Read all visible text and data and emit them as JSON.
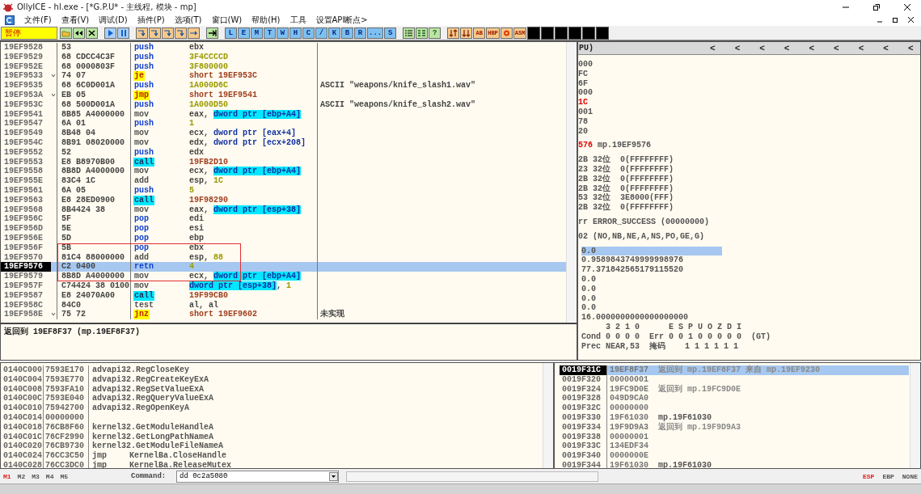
{
  "window": {
    "title": "OllyICE - hl.exe - [*G.P.U* - 主线程, 模块 - mp]"
  },
  "menu": [
    "文件(F)",
    "查看(V)",
    "调试(D)",
    "插件(P)",
    "选项(T)",
    "窗口(W)",
    "帮助(H)",
    "工具",
    "设置API断点>"
  ],
  "toolbar": {
    "status": "暂停",
    "view_buttons": [
      "L",
      "E",
      "M",
      "T",
      "W",
      "H",
      "C",
      "/",
      "K",
      "B",
      "R",
      "...",
      "S"
    ],
    "help_button": "?",
    "tool_labels": [
      "AB",
      "HBP",
      "ASM"
    ]
  },
  "disasm": {
    "rows": [
      {
        "address": "19EF9528",
        "jump_mark": false,
        "bytes": "53",
        "mnemonic": "push",
        "kind": "push",
        "operand": [
          {
            "text": "ebx",
            "kind": "reg"
          }
        ],
        "selected": false
      },
      {
        "address": "19EF9529",
        "jump_mark": false,
        "bytes": "68 CDCC4C3F",
        "mnemonic": "push",
        "kind": "push",
        "operand": [
          {
            "text": "3F4CCCCD",
            "kind": "imm"
          }
        ],
        "selected": false
      },
      {
        "address": "19EF952E",
        "jump_mark": false,
        "bytes": "68 0000803F",
        "mnemonic": "push",
        "kind": "push",
        "operand": [
          {
            "text": "3F800000",
            "kind": "imm"
          }
        ],
        "selected": false
      },
      {
        "address": "19EF9533",
        "jump_mark": true,
        "bytes": "74 07",
        "mnemonic": "je",
        "kind": "jump",
        "operand": [
          {
            "text": "short 19EF953C",
            "kind": "target"
          }
        ],
        "selected": false
      },
      {
        "address": "19EF9535",
        "jump_mark": false,
        "bytes": "68 6C0D001A",
        "mnemonic": "push",
        "kind": "push",
        "operand": [
          {
            "text": "1A000D6C",
            "kind": "imm"
          }
        ],
        "comment": "ASCII \"weapons/knife_slash1.wav\"",
        "selected": false
      },
      {
        "address": "19EF953A",
        "jump_mark": true,
        "bytes": "EB 05",
        "mnemonic": "jmp",
        "kind": "jump",
        "operand": [
          {
            "text": "short 19EF9541",
            "kind": "target"
          }
        ],
        "selected": false
      },
      {
        "address": "19EF953C",
        "jump_mark": false,
        "bytes": "68 500D001A",
        "mnemonic": "push",
        "kind": "push",
        "operand": [
          {
            "text": "1A000D50",
            "kind": "imm"
          }
        ],
        "comment": "ASCII \"weapons/knife_slash2.wav\"",
        "selected": false
      },
      {
        "address": "19EF9541",
        "jump_mark": false,
        "bytes": "8B85 A4000000",
        "mnemonic": "mov",
        "kind": "plain",
        "operand": [
          {
            "text": "eax, ",
            "kind": "reg"
          },
          {
            "text": "dword ptr [ebp+A4]",
            "kind": "mem"
          }
        ],
        "selected": false
      },
      {
        "address": "19EF9547",
        "jump_mark": false,
        "bytes": "6A 01",
        "mnemonic": "push",
        "kind": "push",
        "operand": [
          {
            "text": "1",
            "kind": "imm"
          }
        ],
        "selected": false
      },
      {
        "address": "19EF9549",
        "jump_mark": false,
        "bytes": "8B48 04",
        "mnemonic": "mov",
        "kind": "plain",
        "operand": [
          {
            "text": "ecx, ",
            "kind": "reg"
          },
          {
            "text": "dword ptr [eax+4]",
            "kind": "memref"
          }
        ],
        "selected": false
      },
      {
        "address": "19EF954C",
        "jump_mark": false,
        "bytes": "8B91 08020000",
        "mnemonic": "mov",
        "kind": "plain",
        "operand": [
          {
            "text": "edx, ",
            "kind": "reg"
          },
          {
            "text": "dword ptr [ecx+208]",
            "kind": "memref"
          }
        ],
        "selected": false
      },
      {
        "address": "19EF9552",
        "jump_mark": false,
        "bytes": "52",
        "mnemonic": "push",
        "kind": "push",
        "operand": [
          {
            "text": "edx",
            "kind": "reg"
          }
        ],
        "selected": false
      },
      {
        "address": "19EF9553",
        "jump_mark": false,
        "bytes": "E8 B8970B00",
        "mnemonic": "call",
        "kind": "call",
        "operand": [
          {
            "text": "19FB2D10",
            "kind": "target"
          }
        ],
        "selected": false
      },
      {
        "address": "19EF9558",
        "jump_mark": false,
        "bytes": "8B8D A4000000",
        "mnemonic": "mov",
        "kind": "plain",
        "operand": [
          {
            "text": "ecx, ",
            "kind": "reg"
          },
          {
            "text": "dword ptr [ebp+A4]",
            "kind": "mem"
          }
        ],
        "selected": false
      },
      {
        "address": "19EF955E",
        "jump_mark": false,
        "bytes": "83C4 1C",
        "mnemonic": "add",
        "kind": "plain",
        "operand": [
          {
            "text": "esp, ",
            "kind": "reg"
          },
          {
            "text": "1C",
            "kind": "imm"
          }
        ],
        "selected": false
      },
      {
        "address": "19EF9561",
        "jump_mark": false,
        "bytes": "6A 05",
        "mnemonic": "push",
        "kind": "push",
        "operand": [
          {
            "text": "5",
            "kind": "imm"
          }
        ],
        "selected": false
      },
      {
        "address": "19EF9563",
        "jump_mark": false,
        "bytes": "E8 28ED0900",
        "mnemonic": "call",
        "kind": "call",
        "operand": [
          {
            "text": "19F98290",
            "kind": "target"
          }
        ],
        "selected": false
      },
      {
        "address": "19EF9568",
        "jump_mark": false,
        "bytes": "8B4424 38",
        "mnemonic": "mov",
        "kind": "plain",
        "operand": [
          {
            "text": "eax, ",
            "kind": "reg"
          },
          {
            "text": "dword ptr [esp+38]",
            "kind": "mem"
          }
        ],
        "selected": false
      },
      {
        "address": "19EF956C",
        "jump_mark": false,
        "bytes": "5F",
        "mnemonic": "pop",
        "kind": "pop",
        "operand": [
          {
            "text": "edi",
            "kind": "reg"
          }
        ],
        "selected": false
      },
      {
        "address": "19EF956D",
        "jump_mark": false,
        "bytes": "5E",
        "mnemonic": "pop",
        "kind": "pop",
        "operand": [
          {
            "text": "esi",
            "kind": "reg"
          }
        ],
        "selected": false
      },
      {
        "address": "19EF956E",
        "jump_mark": false,
        "bytes": "5D",
        "mnemonic": "pop",
        "kind": "pop",
        "operand": [
          {
            "text": "ebp",
            "kind": "reg"
          }
        ],
        "selected": false
      },
      {
        "address": "19EF956F",
        "jump_mark": false,
        "bytes": "5B",
        "mnemonic": "pop",
        "kind": "pop",
        "operand": [
          {
            "text": "ebx",
            "kind": "reg"
          }
        ],
        "selected": false
      },
      {
        "address": "19EF9570",
        "jump_mark": false,
        "bytes": "81C4 88000000",
        "mnemonic": "add",
        "kind": "plain",
        "operand": [
          {
            "text": "esp, ",
            "kind": "reg"
          },
          {
            "text": "88",
            "kind": "imm"
          }
        ],
        "selected": false
      },
      {
        "address": "19EF9576",
        "jump_mark": false,
        "bytes": "C2 0400",
        "mnemonic": "retn",
        "kind": "pop",
        "operand": [
          {
            "text": "4",
            "kind": "imm"
          }
        ],
        "selected": true
      },
      {
        "address": "19EF9579",
        "jump_mark": false,
        "bytes": "8B8D A4000000",
        "mnemonic": "mov",
        "kind": "plain",
        "operand": [
          {
            "text": "ecx, ",
            "kind": "reg"
          },
          {
            "text": "dword ptr [ebp+A4]",
            "kind": "mem"
          }
        ],
        "selected": false
      },
      {
        "address": "19EF957F",
        "jump_mark": false,
        "bytes": "C74424 38 0100",
        "mnemonic": "mov",
        "kind": "plain",
        "operand": [
          {
            "text": "dword ptr [esp+38]",
            "kind": "mem"
          },
          {
            "text": ", ",
            "kind": "reg"
          },
          {
            "text": "1",
            "kind": "imm"
          }
        ],
        "selected": false
      },
      {
        "address": "19EF9587",
        "jump_mark": false,
        "bytes": "E8 24070A00",
        "mnemonic": "call",
        "kind": "call",
        "operand": [
          {
            "text": "19F99CB0",
            "kind": "target"
          }
        ],
        "selected": false
      },
      {
        "address": "19EF958C",
        "jump_mark": false,
        "bytes": "84C0",
        "mnemonic": "test",
        "kind": "plain",
        "operand": [
          {
            "text": "al, al",
            "kind": "reg"
          }
        ],
        "selected": false
      },
      {
        "address": "19EF958E",
        "jump_mark": true,
        "bytes": "75 72",
        "mnemonic": "jnz",
        "kind": "jump",
        "operand": [
          {
            "text": "short 19EF9602",
            "kind": "target"
          }
        ],
        "comment": "未实现",
        "selected": false
      }
    ]
  },
  "info": {
    "text": "返回到 19EF8F37 (mp.19EF8F37)"
  },
  "annotation": {
    "kind": "rectangle"
  },
  "registers": {
    "title": "PU)",
    "buttons": [
      "<",
      "<",
      "<",
      "<",
      "<",
      "<",
      "<",
      "<",
      "<"
    ],
    "groups": [
      {
        "kind": "registers",
        "lines": [
          {
            "text": "000",
            "changed": false,
            "selected": false
          },
          {
            "text": "FC",
            "changed": false,
            "selected": false
          },
          {
            "text": "6F",
            "changed": false,
            "selected": false
          },
          {
            "text": "000",
            "changed": false,
            "selected": false
          },
          {
            "text": "1C",
            "changed": true,
            "selected": false
          },
          {
            "text": "001",
            "changed": false,
            "selected": false
          },
          {
            "text": "78",
            "changed": false,
            "selected": false
          },
          {
            "text": "20",
            "changed": false,
            "selected": false
          }
        ]
      },
      {
        "kind": "registers",
        "lines": [
          {
            "text": "576",
            "changed": true,
            "comment": "mp.19EF9576",
            "selected": false
          }
        ]
      },
      {
        "kind": "registers",
        "lines": [
          {
            "text": "2B",
            "changed": false,
            "comment": "32位  0(FFFFFFFF)",
            "selected": false
          },
          {
            "text": "23",
            "changed": false,
            "comment": "32位  0(FFFFFFFF)",
            "selected": false
          },
          {
            "text": "2B",
            "changed": false,
            "comment": "32位  0(FFFFFFFF)",
            "selected": false
          },
          {
            "text": "2B",
            "changed": false,
            "comment": "32位  0(FFFFFFFF)",
            "selected": false
          },
          {
            "text": "53",
            "changed": false,
            "comment": "32位  3E8000(FFF)",
            "selected": false
          },
          {
            "text": "2B",
            "changed": false,
            "comment": "32位  0(FFFFFFFF)",
            "selected": false
          }
        ]
      },
      {
        "kind": "registers",
        "lines": [
          {
            "text": "rr",
            "changed": false,
            "comment": "ERROR_SUCCESS (00000000)",
            "selected": false
          }
        ]
      },
      {
        "kind": "registers",
        "lines": [
          {
            "text": "02",
            "changed": false,
            "comment": "(NO,NB,NE,A,NS,PO,GE,G)",
            "selected": false
          }
        ]
      },
      {
        "kind": "fpu",
        "lines": [
          {
            "text": "0.0",
            "changed": false,
            "selected": true
          },
          {
            "text": "0.9589843749999998976",
            "changed": false,
            "selected": false
          },
          {
            "text": "77.371842565179115520",
            "changed": false,
            "selected": false
          },
          {
            "text": "0.0",
            "changed": false,
            "selected": false
          },
          {
            "text": "0.0",
            "changed": false,
            "selected": false
          },
          {
            "text": "0.0",
            "changed": false,
            "selected": false
          },
          {
            "text": "0.0",
            "changed": false,
            "selected": false
          },
          {
            "text": "16.0000000000000000000",
            "changed": false,
            "selected": false
          },
          {
            "text": "     3 2 1 0      E S P U O Z D I",
            "changed": false,
            "selected": false
          },
          {
            "text": "Cond 0 0 0 0  Err 0 0 1 0 0 0 0 0  (GT)",
            "changed": false,
            "selected": false
          },
          {
            "text": "Prec NEAR,53  掩码    1 1 1 1 1 1",
            "changed": false,
            "selected": false
          }
        ]
      }
    ]
  },
  "dump": {
    "rows": [
      {
        "address": "0140C000",
        "value": "7593E170",
        "comment": "advapi32.RegCloseKey"
      },
      {
        "address": "0140C004",
        "value": "7593E770",
        "comment": "advapi32.RegCreateKeyExA"
      },
      {
        "address": "0140C008",
        "value": "7593FA10",
        "comment": "advapi32.RegSetValueExA"
      },
      {
        "address": "0140C00C",
        "value": "7593E040",
        "comment": "advapi32.RegQueryValueExA"
      },
      {
        "address": "0140C010",
        "value": "75942700",
        "comment": "advapi32.RegOpenKeyA"
      },
      {
        "address": "0140C014",
        "value": "00000000"
      },
      {
        "address": "0140C018",
        "value": "76CB8F60",
        "comment": "kernel32.GetModuleHandleA"
      },
      {
        "address": "0140C01C",
        "value": "76CF2990",
        "comment": "kernel32.GetLongPathNameA"
      },
      {
        "address": "0140C020",
        "value": "76CB9730",
        "comment": "kernel32.GetModuleFileNameA"
      },
      {
        "address": "0140C024",
        "value": "76CC3C50",
        "prefix": "jmp",
        "comment": "KernelBa.CloseHandle"
      },
      {
        "address": "0140C028",
        "value": "76CC3DC0",
        "prefix": "jmp",
        "comment": "KernelBa.ReleaseMutex"
      }
    ]
  },
  "stack": {
    "rows": [
      {
        "address": "0019F31C",
        "value": "19EF8F37",
        "comment": "返回到 mp.19EF8F37 来自 mp.19EF9230",
        "kind": "return",
        "selected": true
      },
      {
        "address": "0019F320",
        "value": "00000001",
        "selected": false
      },
      {
        "address": "0019F324",
        "value": "19FC9D0E",
        "comment": "返回到 mp.19FC9D0E",
        "kind": "return",
        "selected": false
      },
      {
        "address": "0019F328",
        "value": "049D9CA0",
        "selected": false
      },
      {
        "address": "0019F32C",
        "value": "00000000",
        "selected": false
      },
      {
        "address": "0019F330",
        "value": "19F61030",
        "comment": "mp.19F61030",
        "kind": "plain",
        "selected": false
      },
      {
        "address": "0019F334",
        "value": "19F9D9A3",
        "comment": "返回到 mp.19F9D9A3",
        "kind": "return",
        "selected": false
      },
      {
        "address": "0019F338",
        "value": "00000001",
        "selected": false
      },
      {
        "address": "0019F33C",
        "value": "134EDF34",
        "selected": false
      },
      {
        "address": "0019F340",
        "value": "0000000E",
        "selected": false
      },
      {
        "address": "0019F344",
        "value": "19F61030",
        "comment": "mp.19F61030",
        "kind": "plain",
        "selected": false
      }
    ]
  },
  "command_bar": {
    "memory_tabs": [
      {
        "label": "M1",
        "selected": true
      },
      {
        "label": "M2",
        "selected": false
      },
      {
        "label": "M3",
        "selected": false
      },
      {
        "label": "M4",
        "selected": false
      },
      {
        "label": "M5",
        "selected": false
      }
    ],
    "label": "Command:",
    "value": "dd 0c2a5080",
    "register_buttons": [
      {
        "label": "ESP",
        "selected": true
      },
      {
        "label": "EBP",
        "selected": false
      },
      {
        "label": "NONE",
        "selected": false
      }
    ]
  }
}
